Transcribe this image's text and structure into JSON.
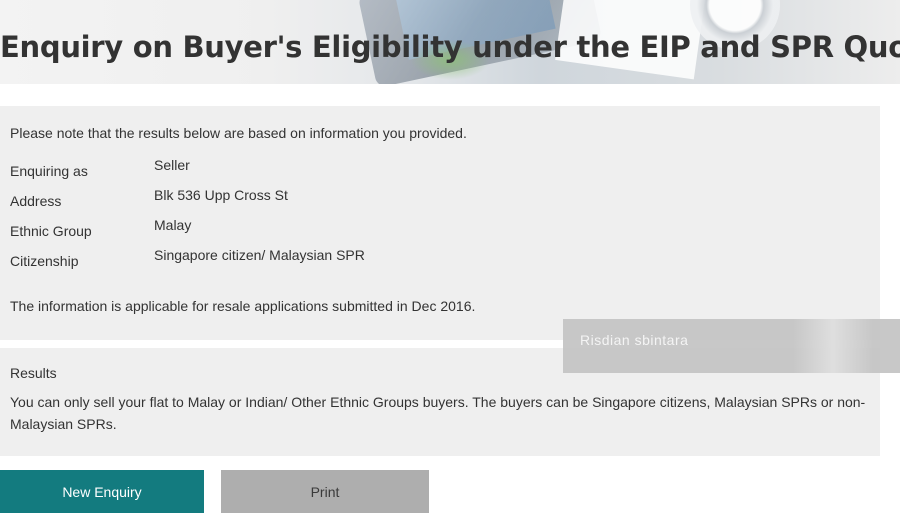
{
  "header": {
    "title": "Enquiry on Buyer's Eligibility under the EIP and SPR Quota"
  },
  "info": {
    "note": "Please note that the results below are based on information you provided.",
    "rows": [
      {
        "label": "Enquiring as",
        "value": "Seller"
      },
      {
        "label": "Address",
        "value": "Blk 536 Upp Cross St"
      },
      {
        "label": "Ethnic Group",
        "value": "Malay"
      },
      {
        "label": "Citizenship",
        "value": "Singapore citizen/ Malaysian SPR"
      }
    ],
    "applicable": "The information is applicable for resale applications submitted in Dec 2016."
  },
  "results": {
    "heading": "Results",
    "text": "You can only sell your flat to Malay or Indian/ Other Ethnic Groups buyers. The buyers can be Singapore citizens, Malaysian SPRs or non-Malaysian SPRs."
  },
  "overlay": {
    "text": "Risdian  sbintara"
  },
  "actions": {
    "new_enquiry_label": "New Enquiry",
    "print_label": "Print"
  },
  "colors": {
    "primary_button": "#137b7f",
    "secondary_button": "#aeaeae",
    "panel_background": "#efefef"
  }
}
